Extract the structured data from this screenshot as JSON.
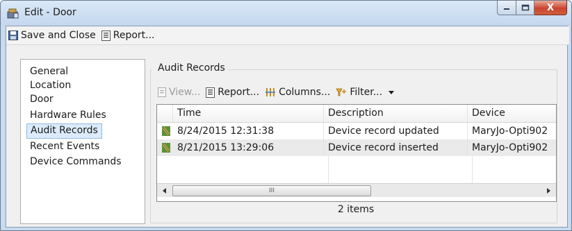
{
  "window": {
    "title": "Edit - Door",
    "close_glyph": "X"
  },
  "toolbar": {
    "save_close_label": "Save and Close",
    "report_label": "Report..."
  },
  "nav": {
    "items": [
      {
        "label": "General"
      },
      {
        "label": "Location"
      },
      {
        "label": "Door"
      },
      {
        "label": "Hardware Rules"
      },
      {
        "label": "Audit Records"
      },
      {
        "label": "Recent Events"
      },
      {
        "label": "Device Commands"
      }
    ],
    "selected": "Audit Records"
  },
  "audit": {
    "section_title": "Audit Records",
    "toolbar": {
      "view_label": "View...",
      "report_label": "Report...",
      "columns_label": "Columns...",
      "filter_label": "Filter..."
    },
    "columns": [
      "Time",
      "Description",
      "Device"
    ],
    "rows": [
      {
        "time": "8/24/2015 12:31:38",
        "description": "Device record updated",
        "device": "MaryJo-Opti902"
      },
      {
        "time": "8/21/2015 13:29:06",
        "description": "Device record inserted",
        "device": "MaryJo-Opti902"
      }
    ],
    "status": "2 items",
    "scroll_thumb_glyph": "III"
  },
  "colors": {
    "selection_bg": "#dcebfb",
    "selection_border": "#8fb9e4",
    "close_button": "#c8452f"
  }
}
